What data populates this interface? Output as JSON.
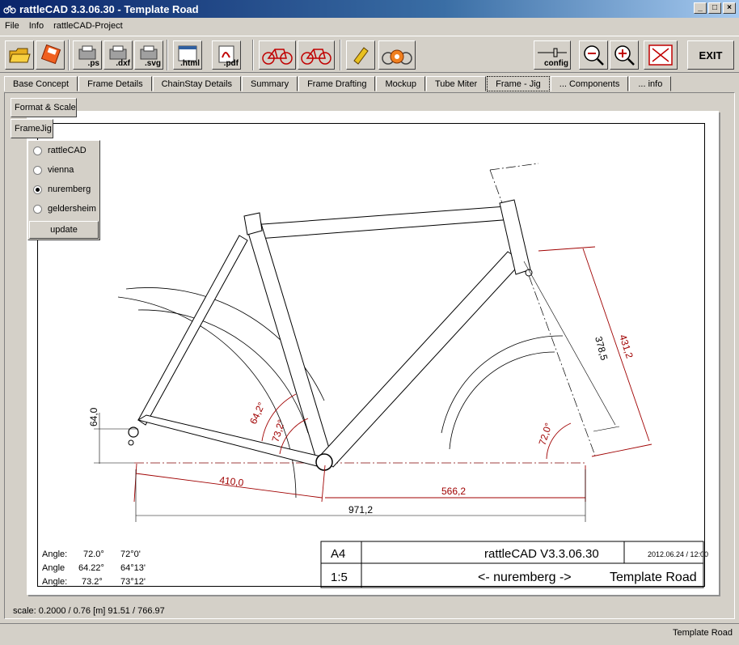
{
  "window": {
    "title": "rattleCAD  3.3.06.30 - Template Road",
    "buttons": [
      "_",
      "□",
      "×"
    ]
  },
  "menu": [
    "File",
    "Info",
    "rattleCAD-Project"
  ],
  "toolbar": {
    "ps": ".ps",
    "dxf": ".dxf",
    "svg": ".svg",
    "html": ".html",
    "pdf": ".pdf",
    "config": "config",
    "exit": "EXIT"
  },
  "tabs": [
    "Base Concept",
    "Frame Details",
    "ChainStay Details",
    "Summary",
    "Frame Drafting",
    "Mockup",
    "Tube Miter",
    "Frame - Jig",
    "... Components",
    "... info"
  ],
  "active_tab": "Frame - Jig",
  "side": {
    "format_scale": "Format & Scale",
    "framejig": "FrameJig",
    "options": [
      "rattleCAD",
      "vienna",
      "nuremberg",
      "geldersheim"
    ],
    "selected": "nuremberg",
    "update": "update"
  },
  "drawing": {
    "dims": {
      "d410": "410,0",
      "d566": "566,2",
      "d971": "971,2",
      "d64": "64,0",
      "d4312": "431,2",
      "d3785": "378,5",
      "a642": "64,2°",
      "a732": "73,2°",
      "a720": "72,0°"
    },
    "angles": [
      {
        "label": "Angle:",
        "dec": "72.0°",
        "dms": "72°0'"
      },
      {
        "label": "Angle",
        "dec": "64.22°",
        "dms": "64°13'"
      },
      {
        "label": "Angle:",
        "dec": "73.2°",
        "dms": "73°12'"
      }
    ],
    "titleblock": {
      "format": "A4",
      "app": "rattleCAD   V3.3.06.30",
      "date": "2012.06.24 / 12:00",
      "scale": "1:5",
      "jig": "<- nuremberg ->",
      "project": "Template Road"
    }
  },
  "scale_text": "scale: 0.2000 / 0.76  [m]  91.51 / 766.97",
  "status": "Template Road",
  "colors": {
    "dimension": "#a00000",
    "titlebar": "#0a246a"
  }
}
